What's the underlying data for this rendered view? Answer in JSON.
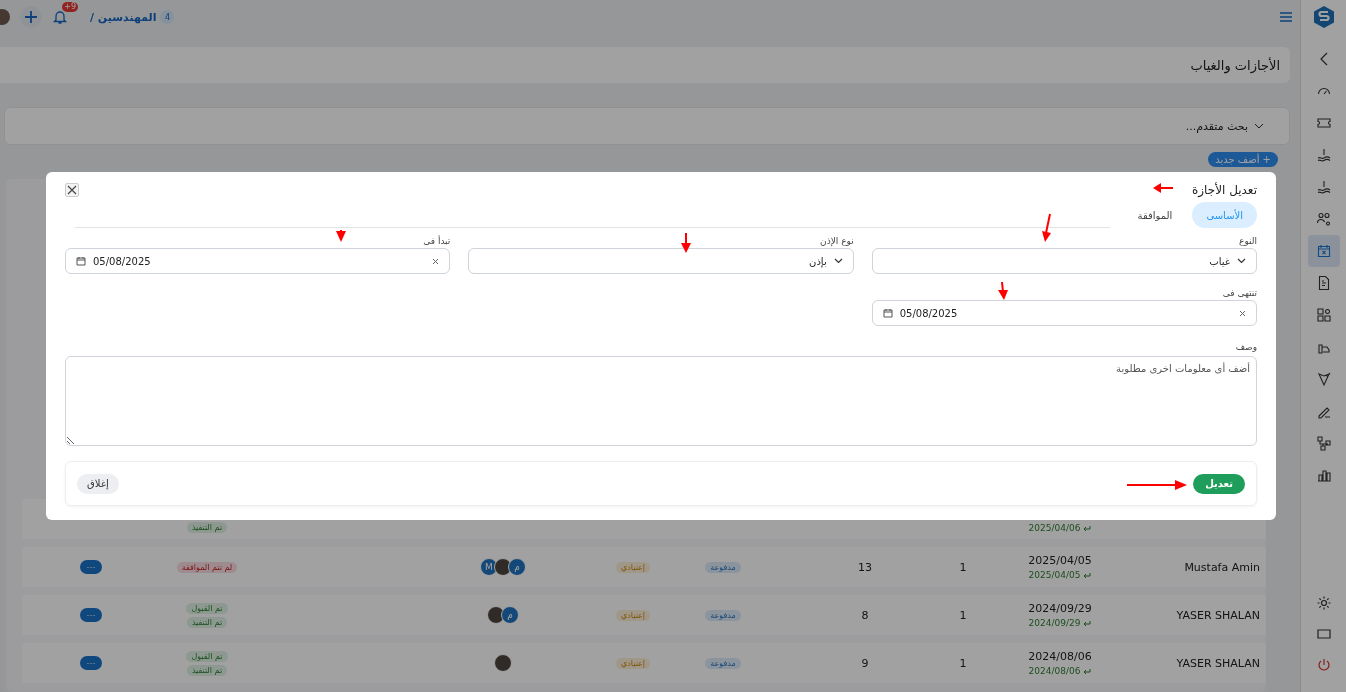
{
  "topbar": {
    "breadcrumb": "المهندسين /",
    "count_badge": "4",
    "notification_badge": "+9"
  },
  "page_title": "الأجازات والغياب",
  "advanced_search": {
    "label": "بحث متقدم...",
    "expanded": false
  },
  "add_button": "+ أضف جديد",
  "sidebar": {
    "items": [
      {
        "selected": false
      },
      {
        "selected": false
      },
      {
        "selected": false
      },
      {
        "selected": false
      },
      {
        "selected": false
      },
      {
        "selected": true
      },
      {
        "selected": false
      },
      {
        "selected": false
      },
      {
        "selected": false
      },
      {
        "selected": false
      },
      {
        "selected": false
      },
      {
        "selected": false
      },
      {
        "selected": false
      }
    ]
  },
  "table": {
    "rows": [
      {
        "sub_date": "2025/04/06",
        "statuses": [
          {
            "label": "تم التنفيذ",
            "kind": "success"
          }
        ]
      },
      {
        "name": "Mustafa Amin",
        "date": "2025/04/05",
        "sub_date": "2025/04/05",
        "qty": "1",
        "days": "13",
        "paid": "مدفوعة",
        "type": "إعتيادي",
        "avatars": [
          {
            "kind": "letter",
            "text": "م"
          },
          {
            "kind": "photo"
          },
          {
            "kind": "letter",
            "text": "M"
          }
        ],
        "statuses": [
          {
            "label": "لم تتم الموافقة",
            "kind": "danger"
          }
        ],
        "more": "···"
      },
      {
        "name": "YASER SHALAN",
        "date": "2024/09/29",
        "sub_date": "2024/09/29",
        "qty": "1",
        "days": "8",
        "paid": "مدفوعة",
        "type": "إعتيادي",
        "avatars": [
          {
            "kind": "letter",
            "text": "م"
          },
          {
            "kind": "photo"
          }
        ],
        "statuses": [
          {
            "label": "تم القبول",
            "kind": "success"
          },
          {
            "label": "تم التنفيذ",
            "kind": "success"
          }
        ],
        "more": "···"
      },
      {
        "name": "YASER SHALAN",
        "date": "2024/08/06",
        "sub_date": "2024/08/06",
        "qty": "1",
        "days": "9",
        "paid": "مدفوعة",
        "type": "إعتيادي",
        "avatars": [
          {
            "kind": "photo"
          }
        ],
        "statuses": [
          {
            "label": "تم القبول",
            "kind": "success"
          },
          {
            "label": "تم التنفيذ",
            "kind": "success"
          }
        ],
        "more": "···"
      }
    ]
  },
  "modal": {
    "title": "تعديل الأجازة",
    "tabs": [
      {
        "label": "الأساسى",
        "selected": true
      },
      {
        "label": "الموافقة",
        "selected": false
      }
    ],
    "fields": [
      {
        "label": "النوع",
        "kind": "select",
        "value": "غياب"
      },
      {
        "label": "نوع الإذن",
        "kind": "select",
        "value": "بإذن"
      },
      {
        "label": "تبدأ فى",
        "kind": "date",
        "value": "05/08/2025"
      },
      {
        "label": "تنتهى فى",
        "kind": "date",
        "value": "05/08/2025"
      }
    ],
    "description": {
      "label": "وصف",
      "placeholder": "أضف أى معلومات اخرى مطلوبة"
    },
    "buttons": [
      {
        "label": "تعديل",
        "kind": "primary"
      },
      {
        "label": "إغلاق",
        "kind": "secondary"
      }
    ]
  }
}
